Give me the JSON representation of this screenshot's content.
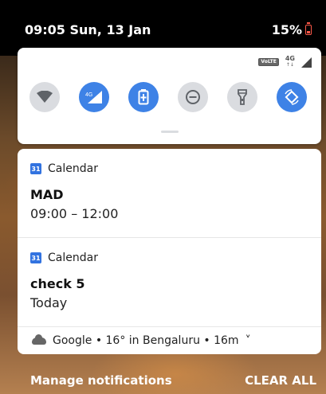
{
  "status_bar": {
    "time_date": "09:05 Sun, 13 Jan",
    "battery_text": "15%",
    "battery_icon": "battery-low-icon",
    "accent_low": "#ff5a4a"
  },
  "quick_settings": {
    "status_icons": {
      "volte": "VoLTE",
      "network": "4G",
      "network_arrows": "↑↓"
    },
    "tiles": [
      {
        "name": "wifi",
        "icon": "wifi-icon",
        "on": false
      },
      {
        "name": "mobile-data",
        "icon": "mobile-data-4g-icon",
        "label": "4G",
        "on": true
      },
      {
        "name": "battery-saver",
        "icon": "battery-saver-icon",
        "on": true
      },
      {
        "name": "do-not-disturb",
        "icon": "do-not-disturb-icon",
        "on": false
      },
      {
        "name": "flashlight",
        "icon": "flashlight-icon",
        "on": false
      },
      {
        "name": "auto-rotate",
        "icon": "auto-rotate-icon",
        "on": true
      }
    ],
    "accent": "#3e82e6"
  },
  "notifications": [
    {
      "app": "Calendar",
      "app_icon_text": "31",
      "title": "MAD",
      "body": "09:00 – 12:00"
    },
    {
      "app": "Calendar",
      "app_icon_text": "31",
      "title": "check 5",
      "body": "Today"
    }
  ],
  "google_weather": {
    "text": "Google • 16° in Bengaluru • 16m",
    "chevron": "˅"
  },
  "footer": {
    "manage_label": "Manage notifications",
    "clear_label": "CLEAR ALL"
  }
}
